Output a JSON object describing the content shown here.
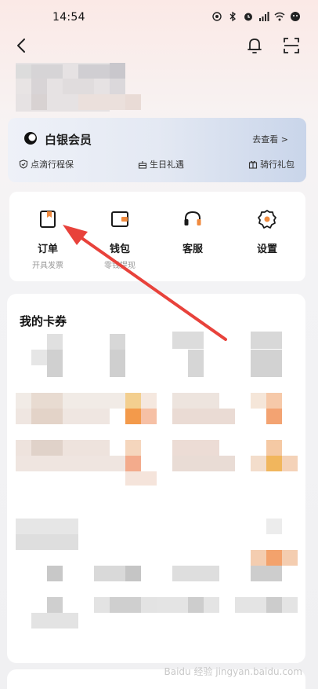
{
  "status_bar": {
    "time": "14:54"
  },
  "vip": {
    "title": "白银会员",
    "link": "去查看 >",
    "benefits": [
      "点滴行程保",
      "生日礼遇",
      "骑行礼包"
    ]
  },
  "quick_actions": [
    {
      "label": "订单",
      "sub": "开具发票"
    },
    {
      "label": "钱包",
      "sub": "零钱提现"
    },
    {
      "label": "客服",
      "sub": ""
    },
    {
      "label": "设置",
      "sub": ""
    }
  ],
  "coupons": {
    "title": "我的卡券"
  },
  "watermark": "Baidu 经验 jingyan.baidu.com",
  "colors": {
    "accent": "#f08a3e",
    "annotation_arrow": "#e8423b",
    "vip_gradient_end": "#c9d5ea"
  },
  "icons": [
    "back-arrow-icon",
    "bell-icon",
    "scan-icon",
    "order-icon",
    "wallet-icon",
    "headset-icon",
    "settings-icon"
  ]
}
